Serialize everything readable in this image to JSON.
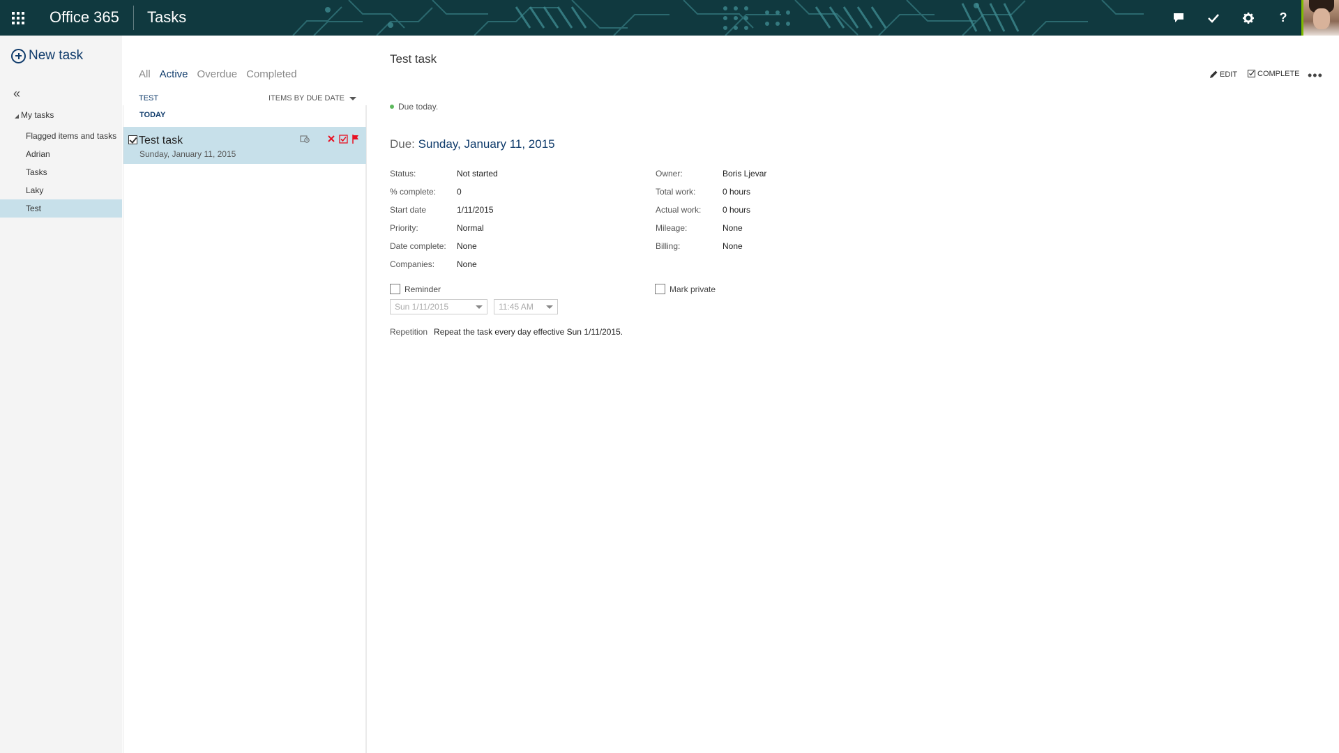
{
  "topbar": {
    "brand": "Office 365",
    "app": "Tasks",
    "icons": [
      "waffle-icon",
      "chat-icon",
      "checkmark-icon",
      "gear-icon",
      "help-icon",
      "avatar"
    ],
    "help_label": "?"
  },
  "leftnav": {
    "new_task": "New task",
    "collapse": "«",
    "group": "My tasks",
    "items": [
      {
        "label": "Flagged items and tasks"
      },
      {
        "label": "Adrian"
      },
      {
        "label": "Tasks"
      },
      {
        "label": "Laky"
      },
      {
        "label": "Test",
        "selected": true
      }
    ]
  },
  "list": {
    "filters": [
      "All",
      "Active",
      "Overdue",
      "Completed"
    ],
    "active_filter": "Active",
    "folder": "TEST",
    "sort": "ITEMS BY DUE DATE",
    "group": "TODAY",
    "tasks": [
      {
        "title": "Test task",
        "date": "Sunday, January 11, 2015"
      }
    ]
  },
  "details": {
    "title": "Test task",
    "commands": {
      "edit": "EDIT",
      "complete": "COMPLETE",
      "more": "•••"
    },
    "due_note": "Due today.",
    "due_label": "Due:",
    "due_value": "Sunday, January 11, 2015",
    "left_fields": [
      {
        "label": "Status:",
        "value": "Not started"
      },
      {
        "label": "% complete:",
        "value": "0"
      },
      {
        "label": "Start date",
        "value": "1/11/2015"
      },
      {
        "label": "Priority:",
        "value": "Normal"
      },
      {
        "label": "Date complete:",
        "value": "None"
      },
      {
        "label": "Companies:",
        "value": "None"
      }
    ],
    "right_fields": [
      {
        "label": "Owner:",
        "value": "Boris Ljevar"
      },
      {
        "label": "Total work:",
        "value": "0 hours"
      },
      {
        "label": "Actual work:",
        "value": "0 hours"
      },
      {
        "label": "Mileage:",
        "value": "None"
      },
      {
        "label": "Billing:",
        "value": "None"
      }
    ],
    "reminder_label": "Reminder",
    "reminder_checked": false,
    "reminder_date": "Sun 1/11/2015",
    "reminder_time": "11:45 AM",
    "private_label": "Mark private",
    "private_checked": false,
    "repetition_label": "Repetition",
    "repetition_value": "Repeat the task every day effective Sun 1/11/2015."
  },
  "colors": {
    "topbar_bg": "#10393f",
    "accent": "#0f3b6b",
    "selection": "#c7e0ea",
    "delete": "#e81123",
    "flag": "#e81123",
    "due_dot": "#5cb85c"
  }
}
